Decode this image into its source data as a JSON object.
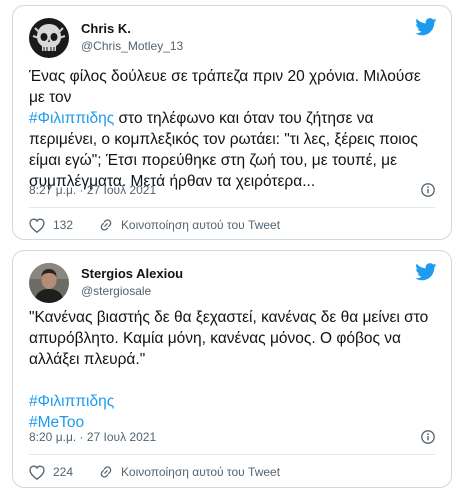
{
  "colors": {
    "accent": "#1d9bf0",
    "text": "#0f1419",
    "muted": "#536471",
    "border": "#cfd9de"
  },
  "tweets": [
    {
      "author_name": "Chris K.",
      "handle": "@Chris_Motley_13",
      "text_line1": "Ένας φίλος δούλευε σε τράπεζα πριν 20 χρόνια. Μιλούσε με τον",
      "hashtag": "#Φιλιππιδης",
      "text_line2": " στο τηλέφωνο και όταν του ζήτησε να περιμένει, ο κομπλεξικός τον ρωτάει: \"τι λες, ξέρεις ποιος είμαι εγώ\"; Έτσι πορεύθηκε στη ζωή του, με τουπέ, με συμπλέγματα. Μετά ήρθαν τα χειρότερα...",
      "timestamp": "8:27 μ.μ. · 27 Ιουλ 2021",
      "likes": "132",
      "share_label": "Κοινοποίηση αυτού του Tweet",
      "avatar_icon": "skull-avatar-icon",
      "platform_icon": "twitter-bird-icon"
    },
    {
      "author_name": "Stergios Alexiou",
      "handle": "@stergiosale",
      "quote": "\"Κανένας βιαστής δε θα ξεχαστεί, κανένας δε θα μείνει στο απυρόβλητο. Καμία μόνη, κανένας μόνος. Ο φόβος να αλλάξει πλευρά.\"",
      "hashtag1": "#Φιλιππιδης",
      "hashtag2": "#MeToo",
      "timestamp": "8:20 μ.μ. · 27 Ιουλ 2021",
      "likes": "224",
      "share_label": "Κοινοποίηση αυτού του Tweet",
      "avatar_icon": "profile-photo-avatar",
      "platform_icon": "twitter-bird-icon"
    }
  ]
}
